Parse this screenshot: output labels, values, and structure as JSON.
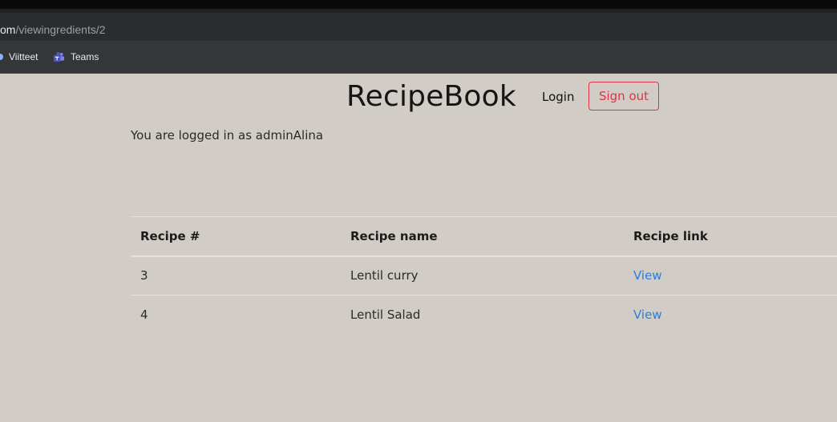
{
  "browser": {
    "url_host": "om",
    "url_path": "/viewingredients/2",
    "bookmarks": [
      {
        "label": "Viitteet",
        "icon": "bookmark-icon"
      },
      {
        "label": "Teams",
        "icon": "teams-icon"
      }
    ]
  },
  "header": {
    "brand": "RecipeBook",
    "login_label": "Login",
    "signout_label": "Sign out"
  },
  "status": {
    "logged_in_text": "You are logged in as adminAlina"
  },
  "table": {
    "headers": [
      "Recipe #",
      "Recipe name",
      "Recipe link"
    ],
    "rows": [
      {
        "number": "3",
        "name": "Lentil curry",
        "link": "View"
      },
      {
        "number": "4",
        "name": "Lentil Salad",
        "link": "View"
      }
    ]
  },
  "colors": {
    "page_background": "#d1ccc5",
    "danger": "#dc3545",
    "link": "#2b7de0"
  }
}
